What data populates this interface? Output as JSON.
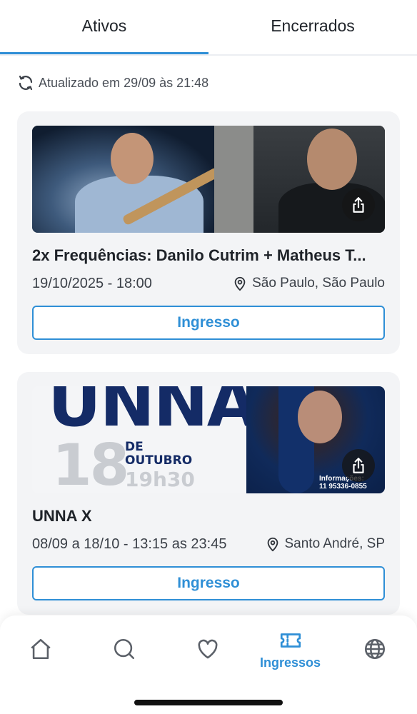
{
  "tabs": [
    {
      "label": "Ativos",
      "active": true
    },
    {
      "label": "Encerrados",
      "active": false
    }
  ],
  "updated_text": "Atualizado em 29/09 às 21:48",
  "events": [
    {
      "title": "2x Frequências: Danilo Cutrim + Matheus T...",
      "date": "19/10/2025 - 18:00",
      "location": "São Paulo, São Paulo",
      "button_label": "Ingresso"
    },
    {
      "title": "UNNA X",
      "date": "08/09 a 18/10 - 13:15 as 23:45",
      "location": "Santo André, SP",
      "button_label": "Ingresso",
      "banner": {
        "headline": "UNNA X",
        "day": "18",
        "month_line1": "DE",
        "month_line2": "OUTUBRO",
        "time": "19h30",
        "info_line1": "Informações:",
        "info_line2": "11 95336-0855"
      }
    }
  ],
  "nav": {
    "items": [
      {
        "icon": "home-icon",
        "label": ""
      },
      {
        "icon": "search-icon",
        "label": ""
      },
      {
        "icon": "heart-icon",
        "label": ""
      },
      {
        "icon": "ticket-icon",
        "label": "Ingressos",
        "active": true
      },
      {
        "icon": "globe-icon",
        "label": ""
      }
    ]
  },
  "colors": {
    "accent": "#2f8fd6",
    "card_bg": "#f3f4f6",
    "banner_navy": "#142b66"
  }
}
